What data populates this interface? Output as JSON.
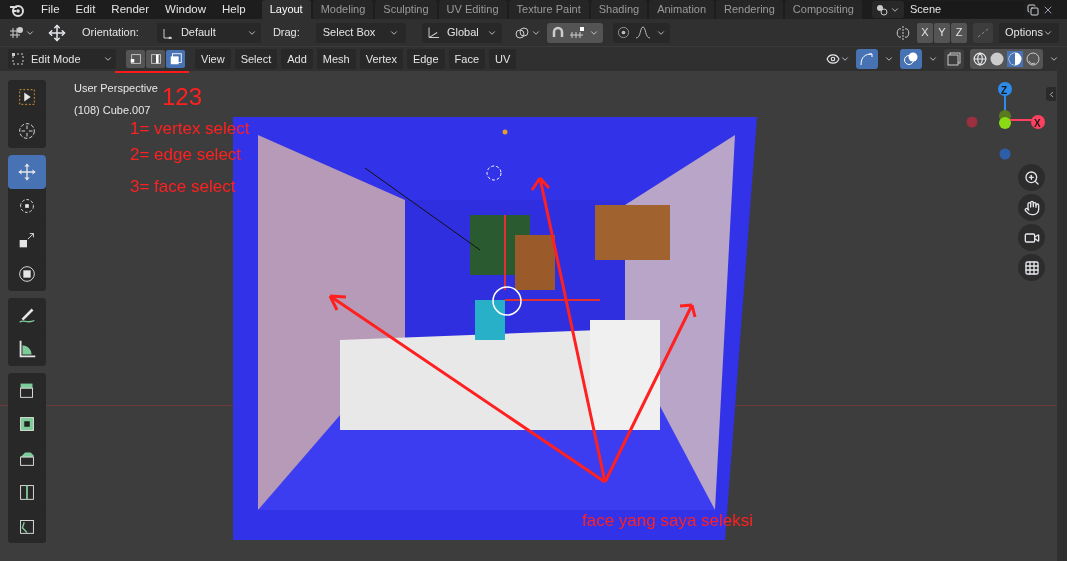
{
  "menu": {
    "items": [
      "File",
      "Edit",
      "Render",
      "Window",
      "Help"
    ]
  },
  "workspaces": [
    {
      "label": "Layout",
      "selected": true
    },
    {
      "label": "Modeling",
      "selected": false
    },
    {
      "label": "Sculpting",
      "selected": false
    },
    {
      "label": "UV Editing",
      "selected": false
    },
    {
      "label": "Texture Paint",
      "selected": false
    },
    {
      "label": "Shading",
      "selected": false
    },
    {
      "label": "Animation",
      "selected": false
    },
    {
      "label": "Rendering",
      "selected": false
    },
    {
      "label": "Compositing",
      "selected": false
    }
  ],
  "scene": {
    "name": "Scene"
  },
  "tool_header": {
    "orientation_label": "Orientation:",
    "orientation": "Default",
    "drag_label": "Drag:",
    "drag": "Select Box",
    "transform_space": "Global",
    "snap_on": true,
    "axes": [
      {
        "label": "X"
      },
      {
        "label": "Y"
      },
      {
        "label": "Z"
      }
    ],
    "options": "Options"
  },
  "viewport_header": {
    "mode": "Edit Mode",
    "select_modes": [
      {
        "selected": false
      },
      {
        "selected": false
      },
      {
        "selected": true
      }
    ],
    "menus": [
      "View",
      "Select",
      "Add",
      "Mesh",
      "Vertex",
      "Edge",
      "Face",
      "UV"
    ]
  },
  "tools": [
    {
      "selected": false
    },
    {
      "selected": false
    },
    {
      "selected": true
    },
    {
      "selected": false
    },
    {
      "selected": false
    },
    {
      "selected": false
    },
    {
      "selected": false
    },
    {
      "selected": false
    },
    {
      "selected": false
    },
    {
      "selected": false
    },
    {
      "selected": false
    },
    {
      "selected": false
    },
    {
      "selected": false
    }
  ],
  "viewport": {
    "view_name": "User Perspective",
    "object_name": "(108) Cube.007",
    "gizmo_axes": [
      {
        "label": "Z"
      },
      {
        "label": "X"
      }
    ]
  },
  "annotations": {
    "numbers": "123",
    "legend": [
      "1= vertex select",
      "2= edge select",
      "3= face select"
    ],
    "caption": "face yang saya seleksi"
  }
}
